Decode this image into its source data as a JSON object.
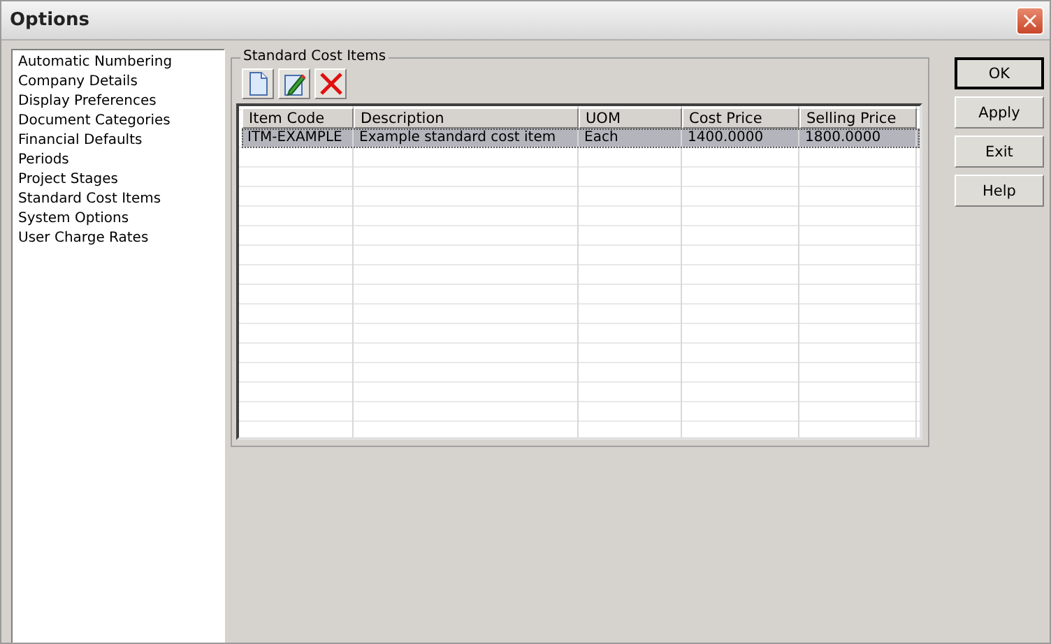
{
  "window": {
    "title": "Options",
    "close": "×"
  },
  "sidebar": {
    "items": [
      {
        "label": "Automatic Numbering",
        "selected": false
      },
      {
        "label": "Company Details",
        "selected": false
      },
      {
        "label": "Display Preferences",
        "selected": false
      },
      {
        "label": "Document Categories",
        "selected": false
      },
      {
        "label": "Financial Defaults",
        "selected": false
      },
      {
        "label": "Periods",
        "selected": false
      },
      {
        "label": "Project Stages",
        "selected": false
      },
      {
        "label": "Standard Cost Items",
        "selected": false
      },
      {
        "label": "System Options",
        "selected": false
      },
      {
        "label": "User Charge Rates",
        "selected": false
      }
    ]
  },
  "panel": {
    "title": "Standard Cost Items",
    "toolbar": [
      {
        "kind": "new"
      },
      {
        "kind": "edit"
      },
      {
        "kind": "delete"
      }
    ],
    "table": {
      "columns": [
        "Item Code",
        "Description",
        "UOM",
        "Cost Price",
        "Selling Price"
      ],
      "rows": [
        {
          "cells": [
            "ITM-EXAMPLE",
            "Example standard cost item",
            "Each",
            "1400.0000",
            "1800.0000"
          ],
          "selected": true
        }
      ]
    }
  },
  "buttons": [
    {
      "label": "OK",
      "default": true
    },
    {
      "label": "Apply",
      "default": false
    },
    {
      "label": "Exit",
      "default": false
    },
    {
      "label": "Help",
      "default": false
    }
  ]
}
